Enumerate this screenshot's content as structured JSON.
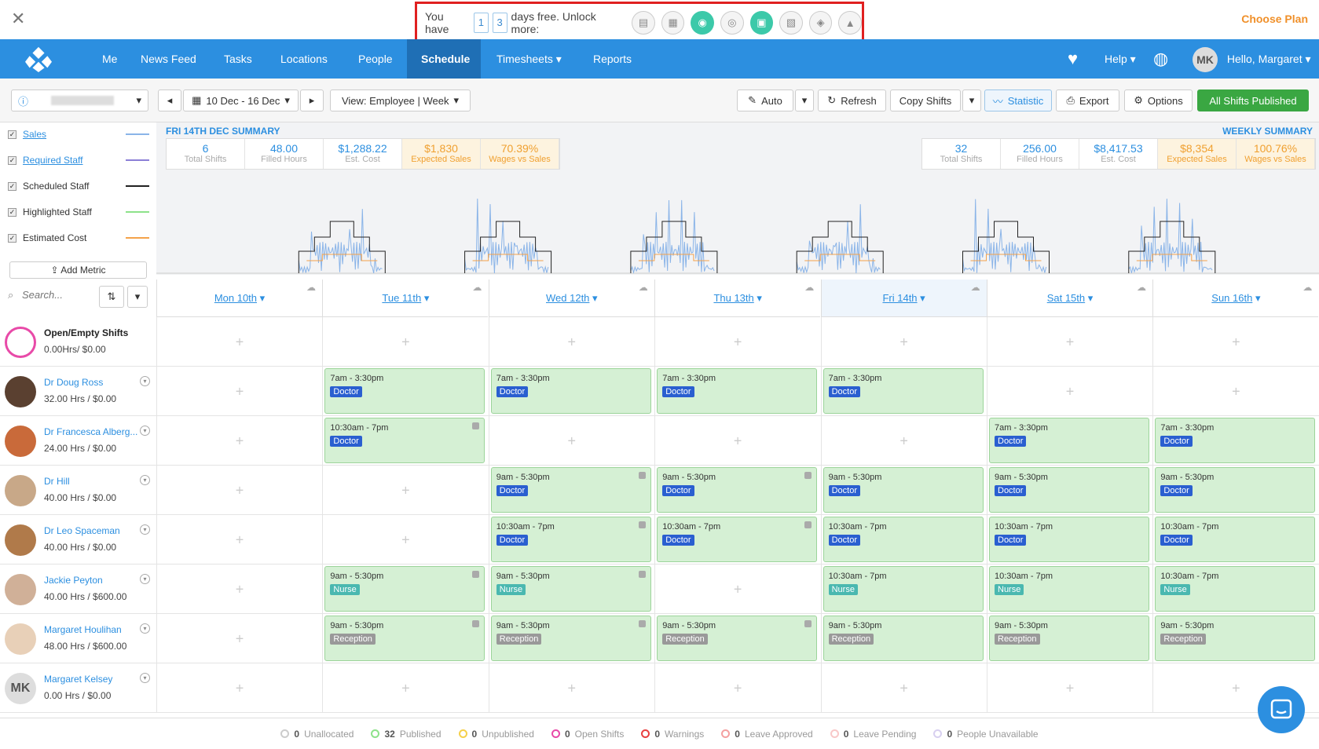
{
  "trial": {
    "prefix": "You have",
    "d1": "1",
    "d2": "3",
    "suffix": "days free. Unlock more:"
  },
  "choose_plan": "Choose Plan",
  "nav": {
    "items": [
      "Me",
      "News Feed",
      "Tasks",
      "Locations",
      "People",
      "Schedule",
      "Timesheets",
      "Reports"
    ],
    "help": "Help",
    "hello": "Hello, Margaret",
    "initials": "MK"
  },
  "toolbar": {
    "date_range": "10 Dec - 16 Dec",
    "view": "View: Employee | Week",
    "auto": "Auto",
    "refresh": "Refresh",
    "copy": "Copy Shifts",
    "statistic": "Statistic",
    "export": "Export",
    "options": "Options",
    "publish": "All Shifts Published"
  },
  "metrics": [
    {
      "label": "Sales",
      "link": true,
      "color": "#8ab4e8"
    },
    {
      "label": "Required Staff",
      "link": true,
      "color": "#8b7fd6"
    },
    {
      "label": "Scheduled Staff",
      "link": false,
      "color": "#222222"
    },
    {
      "label": "Highlighted Staff",
      "link": false,
      "color": "#8de28a"
    },
    {
      "label": "Estimated Cost",
      "link": false,
      "color": "#f4a24a"
    }
  ],
  "add_metric": "Add Metric",
  "search_placeholder": "Search...",
  "daily_summary": {
    "title": "FRI 14TH DEC SUMMARY",
    "cells": [
      [
        "6",
        "Total Shifts"
      ],
      [
        "48.00",
        "Filled Hours"
      ],
      [
        "$1,288.22",
        "Est. Cost"
      ],
      [
        "$1,830",
        "Expected Sales"
      ],
      [
        "70.39%",
        "Wages vs Sales"
      ]
    ]
  },
  "weekly_summary": {
    "title": "WEEKLY SUMMARY",
    "cells": [
      [
        "32",
        "Total Shifts"
      ],
      [
        "256.00",
        "Filled Hours"
      ],
      [
        "$8,417.53",
        "Est. Cost"
      ],
      [
        "$8,354",
        "Expected Sales"
      ],
      [
        "100.76%",
        "Wages vs Sales"
      ]
    ]
  },
  "days": [
    "Mon 10th",
    "Tue 11th",
    "Wed 12th",
    "Thu 13th",
    "Fri 14th",
    "Sat 15th",
    "Sun 16th"
  ],
  "open_shifts": {
    "title": "Open/Empty Shifts",
    "hours": "0.00Hrs/ $0.00"
  },
  "employees": [
    {
      "name": "Dr Doug Ross",
      "hours": "32.00 Hrs / $0.00",
      "shifts": [
        null,
        [
          "7am - 3:30pm",
          "Doctor"
        ],
        [
          "7am - 3:30pm",
          "Doctor"
        ],
        [
          "7am - 3:30pm",
          "Doctor"
        ],
        [
          "7am - 3:30pm",
          "Doctor"
        ],
        null,
        null
      ]
    },
    {
      "name": "Dr Francesca Alberg...",
      "hours": "24.00 Hrs / $0.00",
      "shifts": [
        null,
        [
          "10:30am - 7pm",
          "Doctor"
        ],
        null,
        null,
        null,
        [
          "7am - 3:30pm",
          "Doctor"
        ],
        [
          "7am - 3:30pm",
          "Doctor"
        ]
      ]
    },
    {
      "name": "Dr Hill",
      "hours": "40.00 Hrs / $0.00",
      "shifts": [
        null,
        null,
        [
          "9am - 5:30pm",
          "Doctor"
        ],
        [
          "9am - 5:30pm",
          "Doctor"
        ],
        [
          "9am - 5:30pm",
          "Doctor"
        ],
        [
          "9am - 5:30pm",
          "Doctor"
        ],
        [
          "9am - 5:30pm",
          "Doctor"
        ]
      ]
    },
    {
      "name": "Dr Leo Spaceman",
      "hours": "40.00 Hrs / $0.00",
      "shifts": [
        null,
        null,
        [
          "10:30am - 7pm",
          "Doctor"
        ],
        [
          "10:30am - 7pm",
          "Doctor"
        ],
        [
          "10:30am - 7pm",
          "Doctor"
        ],
        [
          "10:30am - 7pm",
          "Doctor"
        ],
        [
          "10:30am - 7pm",
          "Doctor"
        ]
      ]
    },
    {
      "name": "Jackie Peyton",
      "hours": "40.00 Hrs / $600.00",
      "shifts": [
        null,
        [
          "9am - 5:30pm",
          "Nurse"
        ],
        [
          "9am - 5:30pm",
          "Nurse"
        ],
        null,
        [
          "10:30am - 7pm",
          "Nurse"
        ],
        [
          "10:30am - 7pm",
          "Nurse"
        ],
        [
          "10:30am - 7pm",
          "Nurse"
        ]
      ]
    },
    {
      "name": "Margaret Houlihan",
      "hours": "48.00 Hrs / $600.00",
      "shifts": [
        null,
        [
          "9am - 5:30pm",
          "Reception"
        ],
        [
          "9am - 5:30pm",
          "Reception"
        ],
        [
          "9am - 5:30pm",
          "Reception"
        ],
        [
          "9am - 5:30pm",
          "Reception"
        ],
        [
          "9am - 5:30pm",
          "Reception"
        ],
        [
          "9am - 5:30pm",
          "Reception"
        ]
      ]
    },
    {
      "name": "Margaret Kelsey",
      "hours": "0.00 Hrs / $0.00",
      "initials": "MK",
      "shifts": [
        null,
        null,
        null,
        null,
        null,
        null,
        null
      ]
    }
  ],
  "footer": [
    {
      "count": "0",
      "label": "Unallocated",
      "color": "#cccccc"
    },
    {
      "count": "32",
      "label": "Published",
      "color": "#8de28a"
    },
    {
      "count": "0",
      "label": "Unpublished",
      "color": "#f5d04a"
    },
    {
      "count": "0",
      "label": "Open Shifts",
      "color": "#e84aa8"
    },
    {
      "count": "0",
      "label": "Warnings",
      "color": "#e84040"
    },
    {
      "count": "0",
      "label": "Leave Approved",
      "color": "#f4a0a0"
    },
    {
      "count": "0",
      "label": "Leave Pending",
      "color": "#f8c8c8"
    },
    {
      "count": "0",
      "label": "People Unavailable",
      "color": "#d8d0f0"
    }
  ]
}
